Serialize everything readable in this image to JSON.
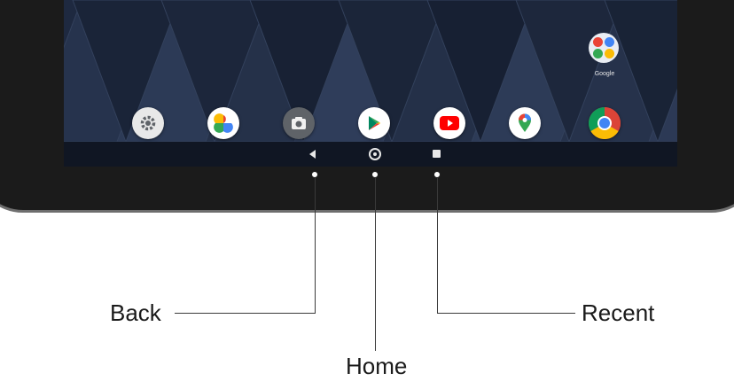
{
  "home_screen": {
    "folder_label": "Google",
    "dock_apps": [
      {
        "icon": "settings-icon",
        "color": "#e8e8e8"
      },
      {
        "icon": "photos-icon",
        "color": "#ffffff"
      },
      {
        "icon": "camera-icon",
        "color": "#5f6368"
      },
      {
        "icon": "play-store-icon",
        "color": "#ffffff"
      },
      {
        "icon": "youtube-icon",
        "color": "#ff0000"
      },
      {
        "icon": "maps-icon",
        "color": "#ffffff"
      },
      {
        "icon": "chrome-icon",
        "color": "#db4437"
      }
    ]
  },
  "callouts": {
    "back": "Back",
    "home": "Home",
    "recent": "Recent"
  }
}
